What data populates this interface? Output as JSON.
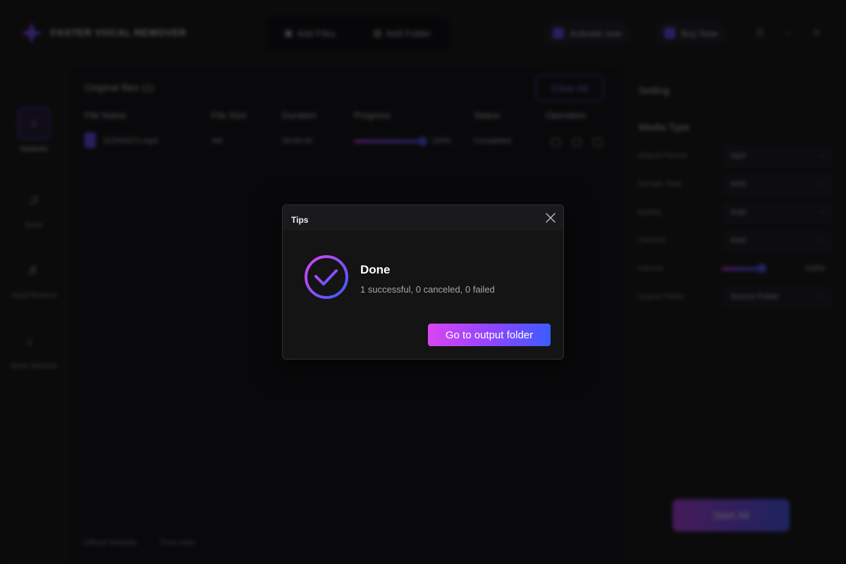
{
  "app": {
    "title": "FASTER VOCAL REMOVER",
    "add_files_label": "Add Files",
    "add_folder_label": "Add Folder",
    "activate_label": "Activate now",
    "buy_label": "Buy Now"
  },
  "sidebar": {
    "items": [
      {
        "label": "Separate"
      },
      {
        "label": "Noise"
      },
      {
        "label": "Vocal Remove"
      },
      {
        "label": "Music Remove"
      }
    ]
  },
  "main": {
    "title": "Original files (1)",
    "clear_all_label": "Clear All",
    "columns": [
      "File Name",
      "File Size",
      "Duration",
      "Progress",
      "Status",
      "Operation"
    ],
    "rows": [
      {
        "name": "2CD9A571.mp3",
        "size": "4M",
        "duration": "00:00:00",
        "progress": 100,
        "progress_label": "100%",
        "status": "Completed"
      }
    ],
    "footer_links": [
      "Official Website",
      "Free Help"
    ]
  },
  "settings": {
    "title": "Setting",
    "media_type_label": "Media Type",
    "rows": [
      {
        "label": "Output Format",
        "value": "mp3"
      },
      {
        "label": "Sample Rate",
        "value": "Auto"
      },
      {
        "label": "Quality",
        "value": "Auto"
      },
      {
        "label": "Channel",
        "value": "Auto"
      },
      {
        "label": "Volume",
        "value": "100%"
      },
      {
        "label": "Output Folder",
        "value": "Source Folder"
      }
    ],
    "start_all_label": "Start All"
  },
  "dialog": {
    "title": "Tips",
    "heading": "Done",
    "summary": "1 successful, 0 canceled, 0 failed",
    "primary_button": "Go to output folder"
  },
  "colors": {
    "accent_start": "#d945f2",
    "accent_mid": "#8a46ff",
    "accent_end": "#3b5cff",
    "modal_bg": "#141414"
  }
}
